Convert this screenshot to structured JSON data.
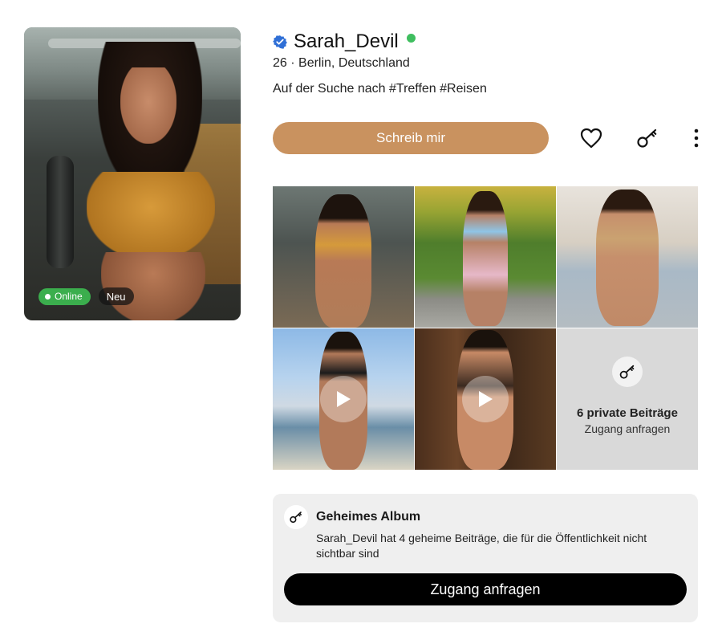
{
  "profile": {
    "username": "Sarah_Devil",
    "meta": "26 · Berlin, Deutschland",
    "bio": "Auf der Suche nach #Treffen #Reisen",
    "badges": {
      "online": "Online",
      "new": "Neu"
    }
  },
  "actions": {
    "message_label": "Schreib mir",
    "icons": [
      "heart-icon",
      "key-icon",
      "more-vertical-icon"
    ]
  },
  "grid": {
    "private_title": "6 private Beiträge",
    "private_sub": "Zugang anfragen"
  },
  "secret_album": {
    "title": "Geheimes Album",
    "text": "Sarah_Devil hat 4 geheime Beiträge, die für die Öffentlichkeit nicht sichtbar sind",
    "button_label": "Zugang anfragen"
  },
  "colors": {
    "accent": "#c9925f",
    "online_green": "#3bae4d",
    "verified_blue": "#2f6fd6",
    "dark_button": "#000000"
  }
}
